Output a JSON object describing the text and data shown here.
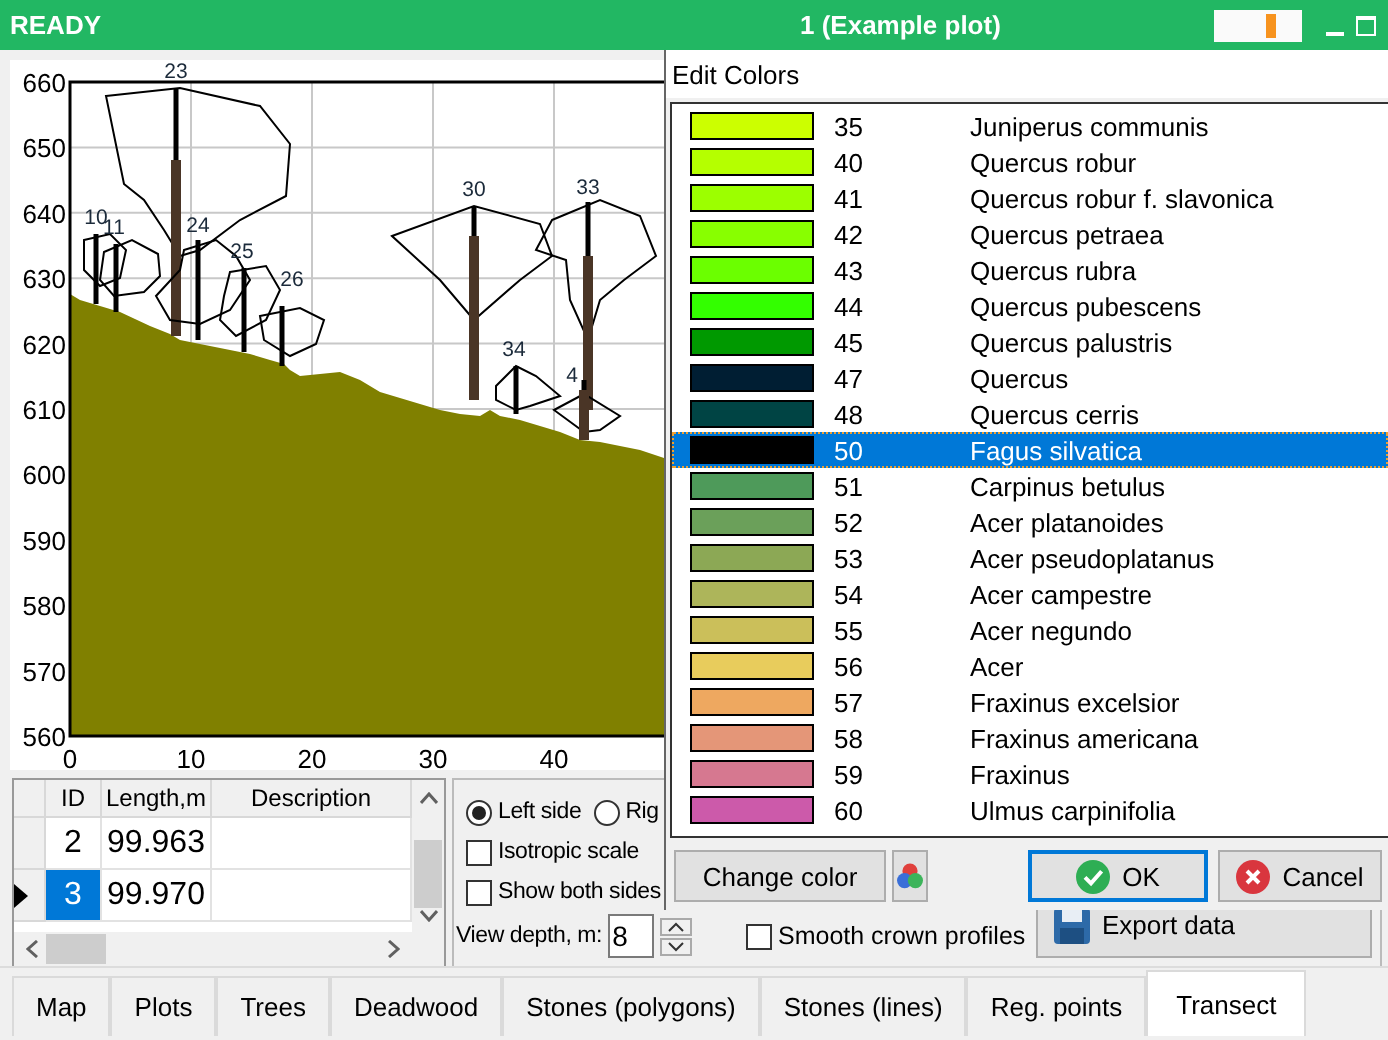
{
  "status": "READY",
  "window": {
    "title": "1 (Example plot)"
  },
  "plot": {
    "y_ticks": [
      "660",
      "650",
      "640",
      "630",
      "620",
      "610",
      "600",
      "590",
      "580",
      "570",
      "560"
    ],
    "x_ticks": [
      "0",
      "10",
      "20",
      "30",
      "40"
    ],
    "tree_labels": [
      "10",
      "11",
      "23",
      "24",
      "25",
      "26",
      "30",
      "33",
      "34",
      "4"
    ]
  },
  "table": {
    "columns": [
      "ID",
      "Length,m",
      "Description"
    ],
    "rows": [
      {
        "id": "2",
        "length": "99.963",
        "selected": false
      },
      {
        "id": "3",
        "length": "99.970",
        "selected": true
      }
    ]
  },
  "options": {
    "radios": [
      {
        "label": "Left side",
        "selected": true
      },
      {
        "label": "Rig",
        "selected": false
      }
    ],
    "checkboxes": [
      {
        "label": "Isotropic scale",
        "checked": false
      },
      {
        "label": "Show both sides",
        "checked": false
      }
    ],
    "view_depth": {
      "label": "View depth, m:",
      "value": "8"
    },
    "smooth_crown": {
      "label": "Smooth crown profiles",
      "checked": false
    },
    "export_button": "Export data"
  },
  "tabs": [
    {
      "label": "Map",
      "selected": false
    },
    {
      "label": "Plots",
      "selected": false
    },
    {
      "label": "Trees",
      "selected": false
    },
    {
      "label": "Deadwood",
      "selected": false
    },
    {
      "label": "Stones (polygons)",
      "selected": false
    },
    {
      "label": "Stones (lines)",
      "selected": false
    },
    {
      "label": "Reg. points",
      "selected": false
    },
    {
      "label": "Transect",
      "selected": true
    }
  ],
  "dialog": {
    "title": "Edit Colors",
    "species": [
      {
        "code": "35",
        "name": "Juniperus communis",
        "color": "#ccff00",
        "selected": false
      },
      {
        "code": "40",
        "name": "Quercus robur",
        "color": "#b5ff00",
        "selected": false
      },
      {
        "code": "41",
        "name": "Quercus robur f. slavonica",
        "color": "#9cff00",
        "selected": false
      },
      {
        "code": "42",
        "name": "Quercus petraea",
        "color": "#88ff00",
        "selected": false
      },
      {
        "code": "43",
        "name": "Quercus rubra",
        "color": "#6bff00",
        "selected": false
      },
      {
        "code": "44",
        "name": "Quercus pubescens",
        "color": "#33ff00",
        "selected": false
      },
      {
        "code": "45",
        "name": "Quercus palustris",
        "color": "#009900",
        "selected": false
      },
      {
        "code": "47",
        "name": "Quercus",
        "color": "#001e33",
        "selected": false
      },
      {
        "code": "48",
        "name": "Quercus cerris",
        "color": "#004444",
        "selected": false
      },
      {
        "code": "50",
        "name": "Fagus silvatica",
        "color": "#000000",
        "selected": true
      },
      {
        "code": "51",
        "name": "Carpinus betulus",
        "color": "#4e9a5a",
        "selected": false
      },
      {
        "code": "52",
        "name": "Acer platanoides",
        "color": "#6ba05a",
        "selected": false
      },
      {
        "code": "53",
        "name": "Acer pseudoplatanus",
        "color": "#8ca855",
        "selected": false
      },
      {
        "code": "54",
        "name": "Acer campestre",
        "color": "#adb55a",
        "selected": false
      },
      {
        "code": "55",
        "name": "Acer negundo",
        "color": "#cbbf5a",
        "selected": false
      },
      {
        "code": "56",
        "name": "Acer",
        "color": "#e8cc5c",
        "selected": false
      },
      {
        "code": "57",
        "name": "Fraxinus excelsior",
        "color": "#eea860",
        "selected": false
      },
      {
        "code": "58",
        "name": "Fraxinus americana",
        "color": "#e49678",
        "selected": false
      },
      {
        "code": "59",
        "name": "Fraxinus",
        "color": "#d67890",
        "selected": false
      },
      {
        "code": "60",
        "name": "Ulmus carpinifolia",
        "color": "#cc5aaa",
        "selected": false
      }
    ],
    "change_color_button": "Change color",
    "ok_button": "OK",
    "cancel_button": "Cancel"
  }
}
